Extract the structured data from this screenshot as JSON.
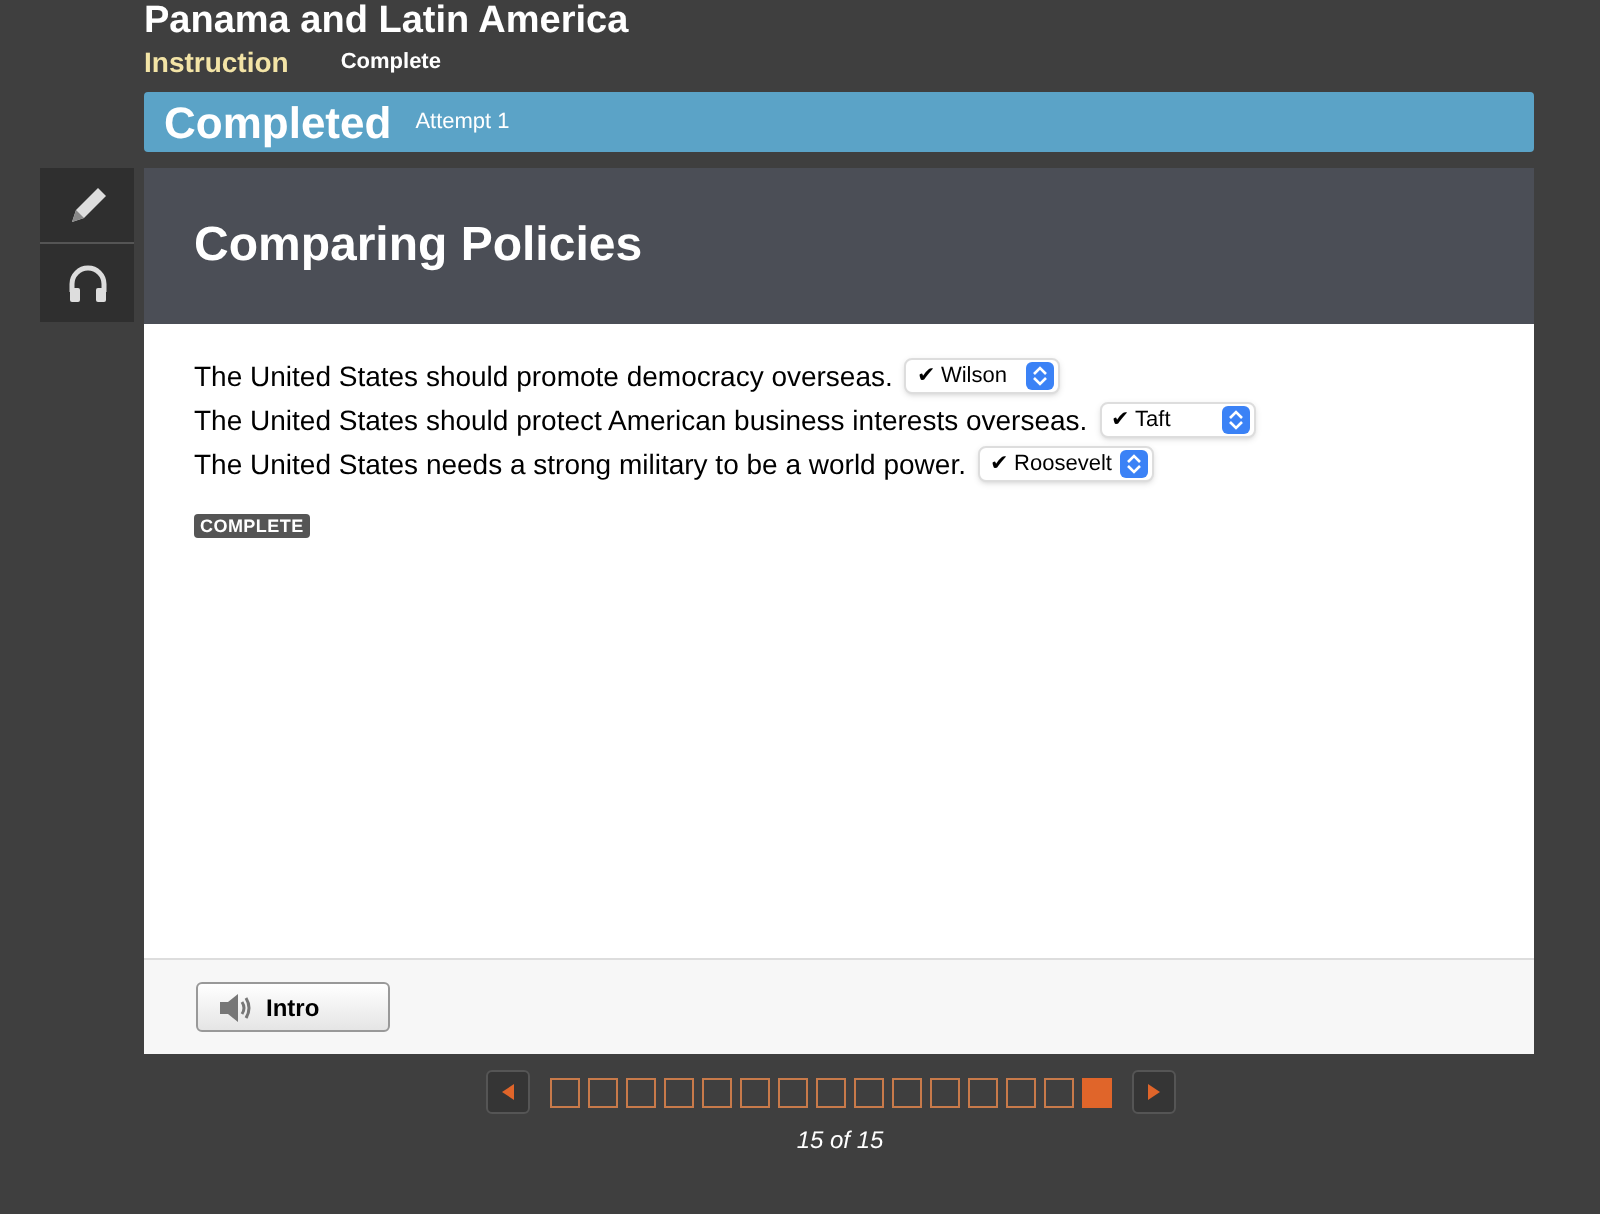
{
  "course_title": "Panama and Latin America",
  "tabs": [
    {
      "label": "Instruction",
      "selected": true
    },
    {
      "label": "Complete",
      "selected": false
    }
  ],
  "status_bar": {
    "status": "Completed",
    "attempt": "Attempt 1"
  },
  "activity": {
    "title": "Comparing Policies",
    "statements": [
      {
        "text": "The United States should promote democracy overseas.",
        "answer": "✔ Wilson"
      },
      {
        "text": "The United States should protect American business interests overseas.",
        "answer": "✔ Taft"
      },
      {
        "text": "The United States needs a strong military to be a world power.",
        "answer": "✔ Roosevelt"
      }
    ],
    "badge": "COMPLETE"
  },
  "footer": {
    "intro_button": "Intro"
  },
  "pager": {
    "pages": [
      {
        "selected": false
      },
      {
        "selected": false
      },
      {
        "selected": false
      },
      {
        "selected": false
      },
      {
        "selected": false
      },
      {
        "selected": false
      },
      {
        "selected": false
      },
      {
        "selected": false
      },
      {
        "selected": false
      },
      {
        "selected": false
      },
      {
        "selected": false
      },
      {
        "selected": false
      },
      {
        "selected": false
      },
      {
        "selected": false
      },
      {
        "selected": true
      }
    ],
    "label": "15 of 15"
  }
}
